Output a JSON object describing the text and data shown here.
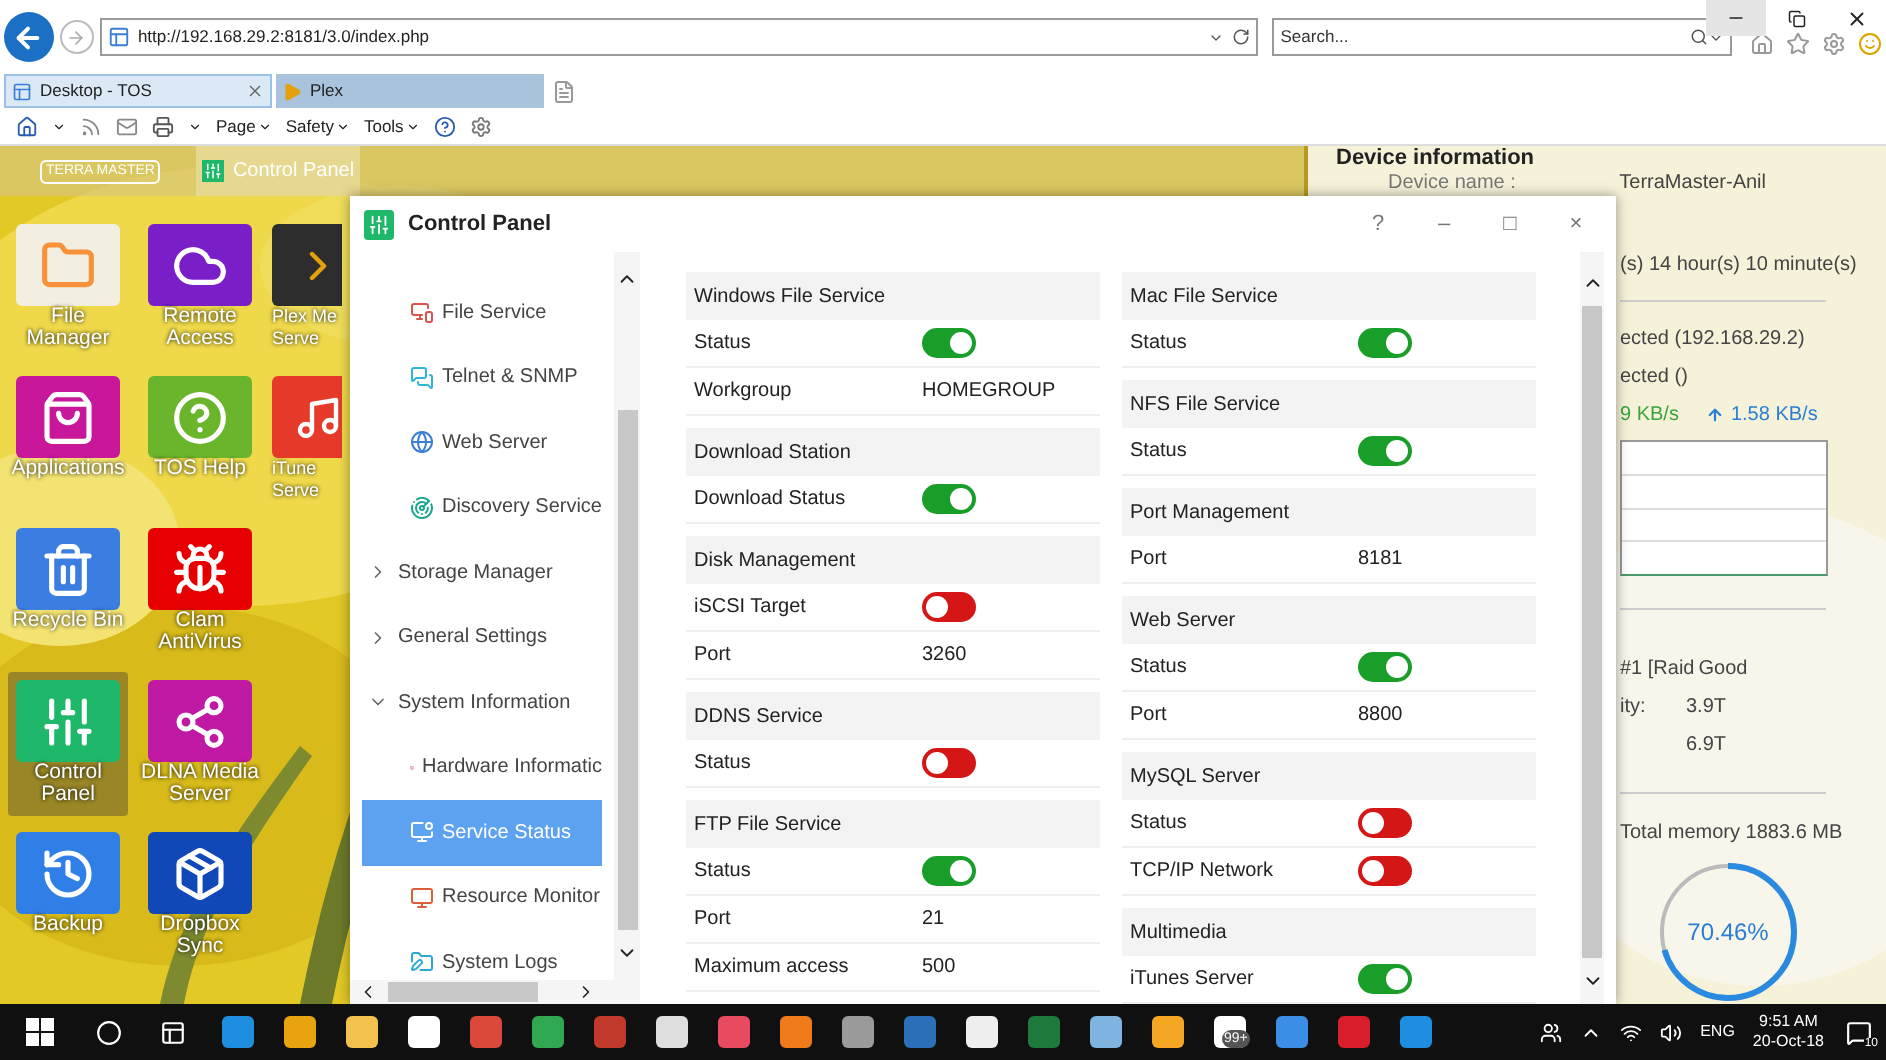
{
  "browser": {
    "address": "http://192.168.29.2:8181/3.0/index.php",
    "search_placeholder": "Search...",
    "tabs": [
      {
        "title": "Desktop - TOS",
        "selected": true
      },
      {
        "title": "Plex",
        "selected": false
      }
    ],
    "menus": [
      "Page",
      "Safety",
      "Tools"
    ]
  },
  "tos_bar": {
    "logo": "TERRA MASTER",
    "app": "Control Panel"
  },
  "desktop_icons": [
    {
      "kind": "folder",
      "color": "#f3efe0",
      "lines": [
        "File",
        "Manager"
      ],
      "selected": false
    },
    {
      "kind": "bag",
      "color": "#c8179b",
      "lines": [
        "Applications"
      ],
      "selected": false
    },
    {
      "kind": "trash",
      "color": "#3b7de0",
      "lines": [
        "Recycle Bin"
      ],
      "selected": false
    },
    {
      "kind": "sliders",
      "color": "#1fb86a",
      "lines": [
        "Control",
        "Panel"
      ],
      "selected": true
    },
    {
      "kind": "history",
      "color": "#2f7fe6",
      "lines": [
        "Backup"
      ],
      "selected": false
    },
    {
      "kind": "cloud",
      "color": "#7a1fc8",
      "lines": [
        "Remote",
        "Access"
      ],
      "selected": false
    },
    {
      "kind": "help",
      "color": "#6bb52c",
      "lines": [
        "TOS Help"
      ],
      "selected": false
    },
    {
      "kind": "bug",
      "color": "#e60000",
      "lines": [
        "Clam",
        "AntiVirus"
      ],
      "selected": false
    },
    {
      "kind": "share",
      "color": "#c01aa5",
      "lines": [
        "DLNA Media",
        "Server"
      ],
      "selected": false
    },
    {
      "kind": "box",
      "color": "#1048b8",
      "lines": [
        "Dropbox",
        "Sync"
      ],
      "selected": false
    },
    {
      "kind": "plex",
      "color": "#2d2d2d",
      "lines": [
        "Plex Me",
        "Serve"
      ],
      "selected": false
    },
    {
      "kind": "music",
      "color": "#e63a2a",
      "lines": [
        "iTune",
        "Serve"
      ],
      "selected": false
    }
  ],
  "device_info": {
    "title": "Device information",
    "name_label": "Device name :",
    "name_value": "TerraMaster-Anil",
    "uptime": "(s) 14 hour(s) 10 minute(s)",
    "lan1": "ected (192.168.29.2)",
    "lan2": "ected ()",
    "download": "9 KB/s",
    "upload": "1.58 KB/s",
    "volume": "#1 [Raid",
    "volume_status": "Good",
    "capacity_label": "ity:",
    "capacity": "3.9T",
    "total": "6.9T",
    "memory": "Total memory 1883.6 MB",
    "memory_usage": {
      "reading": "70.46%",
      "level": 0.7046
    }
  },
  "control_panel": {
    "title": "Control Panel",
    "window_buttons": [
      "?",
      "–",
      "□",
      "×"
    ],
    "sidebar": [
      {
        "kind": "item",
        "label": "File Service",
        "selected": false
      },
      {
        "kind": "item",
        "label": "Telnet & SNMP",
        "selected": false
      },
      {
        "kind": "item",
        "label": "Web Server",
        "selected": false
      },
      {
        "kind": "item",
        "label": "Discovery Service",
        "selected": false
      },
      {
        "kind": "group",
        "label": "Storage Manager",
        "expanded": false
      },
      {
        "kind": "group",
        "label": "General Settings",
        "expanded": false
      },
      {
        "kind": "group",
        "label": "System Information",
        "expanded": true
      },
      {
        "kind": "item",
        "label": "Hardware Informatic",
        "selected": false
      },
      {
        "kind": "item",
        "label": "Service Status",
        "selected": true
      },
      {
        "kind": "item",
        "label": "Resource Monitor",
        "selected": false
      },
      {
        "kind": "item",
        "label": "System Logs",
        "selected": false
      }
    ],
    "columns": [
      [
        {
          "title": "Windows File Service",
          "rows": [
            {
              "label": "Status",
              "kind": "toggle",
              "on": true
            },
            {
              "label": "Workgroup",
              "kind": "text",
              "value": "HOMEGROUP"
            }
          ]
        },
        {
          "title": "Download Station",
          "rows": [
            {
              "label": "Download Status",
              "kind": "toggle",
              "on": true
            }
          ]
        },
        {
          "title": "Disk Management",
          "rows": [
            {
              "label": "iSCSI Target",
              "kind": "toggle",
              "on": false
            },
            {
              "label": "Port",
              "kind": "text",
              "value": "3260"
            }
          ]
        },
        {
          "title": "DDNS Service",
          "rows": [
            {
              "label": "Status",
              "kind": "toggle",
              "on": false
            }
          ]
        },
        {
          "title": "FTP File Service",
          "rows": [
            {
              "label": "Status",
              "kind": "toggle",
              "on": true
            },
            {
              "label": "Port",
              "kind": "text",
              "value": "21"
            },
            {
              "label": "Maximum access",
              "kind": "text",
              "value": "500"
            }
          ]
        }
      ],
      [
        {
          "title": "Mac File Service",
          "rows": [
            {
              "label": "Status",
              "kind": "toggle",
              "on": true
            }
          ]
        },
        {
          "title": "NFS File Service",
          "rows": [
            {
              "label": "Status",
              "kind": "toggle",
              "on": true
            }
          ]
        },
        {
          "title": "Port Management",
          "rows": [
            {
              "label": "Port",
              "kind": "text",
              "value": "8181"
            }
          ]
        },
        {
          "title": "Web Server",
          "rows": [
            {
              "label": "Status",
              "kind": "toggle",
              "on": true
            },
            {
              "label": "Port",
              "kind": "text",
              "value": "8800"
            }
          ]
        },
        {
          "title": "MySQL Server",
          "rows": [
            {
              "label": "Status",
              "kind": "toggle",
              "on": false
            },
            {
              "label": "TCP/IP Network",
              "kind": "toggle",
              "on": false
            }
          ]
        },
        {
          "title": "Multimedia",
          "rows": [
            {
              "label": "iTunes Server",
              "kind": "toggle",
              "on": true
            }
          ]
        }
      ]
    ]
  },
  "taskbar": {
    "apps": [
      {
        "color": "#1e8fe0"
      },
      {
        "color": "#e8a30f"
      },
      {
        "color": "#f2c14e"
      },
      {
        "color": "#ffffff"
      },
      {
        "color": "#d9483b"
      },
      {
        "color": "#2fa84f"
      },
      {
        "color": "#c0392b"
      },
      {
        "color": "#dddddd"
      },
      {
        "color": "#e84a5f"
      },
      {
        "color": "#f07b1a"
      },
      {
        "color": "#9a9a9a"
      },
      {
        "color": "#2a6fb8"
      },
      {
        "color": "#eeeeee"
      },
      {
        "color": "#1d7a3c"
      },
      {
        "color": "#7fb3e0"
      },
      {
        "color": "#f5a623"
      },
      {
        "color": "#ffffff",
        "badge": "99+"
      },
      {
        "color": "#3a8ee6"
      },
      {
        "color": "#d81e2a"
      },
      {
        "color": "#1e8fe0"
      }
    ],
    "language": "ENG",
    "time": "9:51 AM",
    "date": "20-Oct-18",
    "notifications": "10"
  }
}
